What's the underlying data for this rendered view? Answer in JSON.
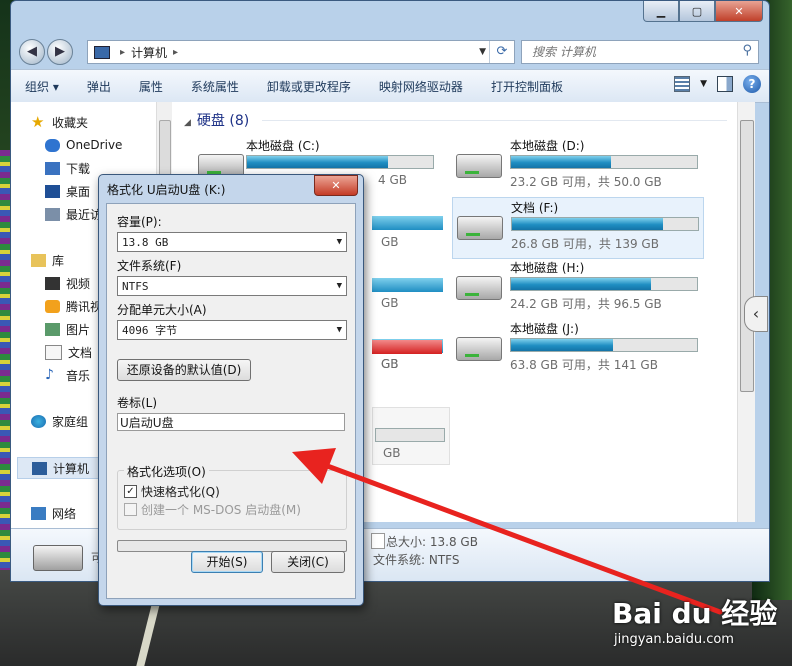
{
  "explorer": {
    "address": {
      "path": "计算机"
    },
    "search_placeholder": "搜索 计算机",
    "toolbar": [
      "组织",
      "弹出",
      "属性",
      "系统属性",
      "卸载或更改程序",
      "映射网络驱动器",
      "打开控制面板"
    ],
    "nav": {
      "favorites": "收藏夹",
      "fav_items": [
        "OneDrive",
        "下载",
        "桌面",
        "最近访"
      ],
      "library": "库",
      "lib_items": [
        "视频",
        "腾讯视",
        "图片",
        "文档",
        "音乐"
      ],
      "homegroup": "家庭组",
      "computer": "计算机",
      "network": "网络"
    },
    "group_title": "硬盘 (8)",
    "drives": [
      {
        "name": "本地磁盘 (C:)",
        "info": "4 GB",
        "fill": 0.76
      },
      {
        "name": "本地磁盘 (D:)",
        "info": "23.2 GB 可用，共 50.0 GB",
        "fill": 0.54
      },
      {
        "name": "文档 (F:)",
        "info": "26.8 GB 可用，共 139 GB",
        "fill": 0.81
      },
      {
        "name": "本地磁盘 (H:)",
        "info": "24.2 GB 可用，共 96.5 GB",
        "fill": 0.75
      },
      {
        "name": "本地磁盘 (J:)",
        "info": "63.8 GB 可用，共 141 GB",
        "fill": 0.55
      }
    ],
    "partial_infos": [
      "GB",
      "GB",
      "GB",
      "GB",
      "GB"
    ],
    "details": {
      "total": "总大小: 13.8 GB",
      "fs": "文件系统: NTFS",
      "cut": "可"
    }
  },
  "dialog": {
    "title": "格式化 U启动U盘 (K:)",
    "capacity_label": "容量(P):",
    "capacity_value": "13.8 GB",
    "fs_label": "文件系统(F)",
    "fs_value": "NTFS",
    "alloc_label": "分配单元大小(A)",
    "alloc_value": "4096 字节",
    "restore_button": "还原设备的默认值(D)",
    "volume_label": "卷标(L)",
    "volume_value": "U启动U盘",
    "options_legend": "格式化选项(O)",
    "quick_format": "快速格式化(Q)",
    "msdos": "创建一个 MS-DOS 启动盘(M)",
    "start_button": "开始(S)",
    "close_button": "关闭(C)"
  },
  "watermark": {
    "logo": "Bai du 经验",
    "url": "jingyan.baidu.com"
  },
  "colors": {
    "drive_fill": "#1f8ec2",
    "arrow": "#e8231f",
    "drive_red": "#d42020"
  }
}
